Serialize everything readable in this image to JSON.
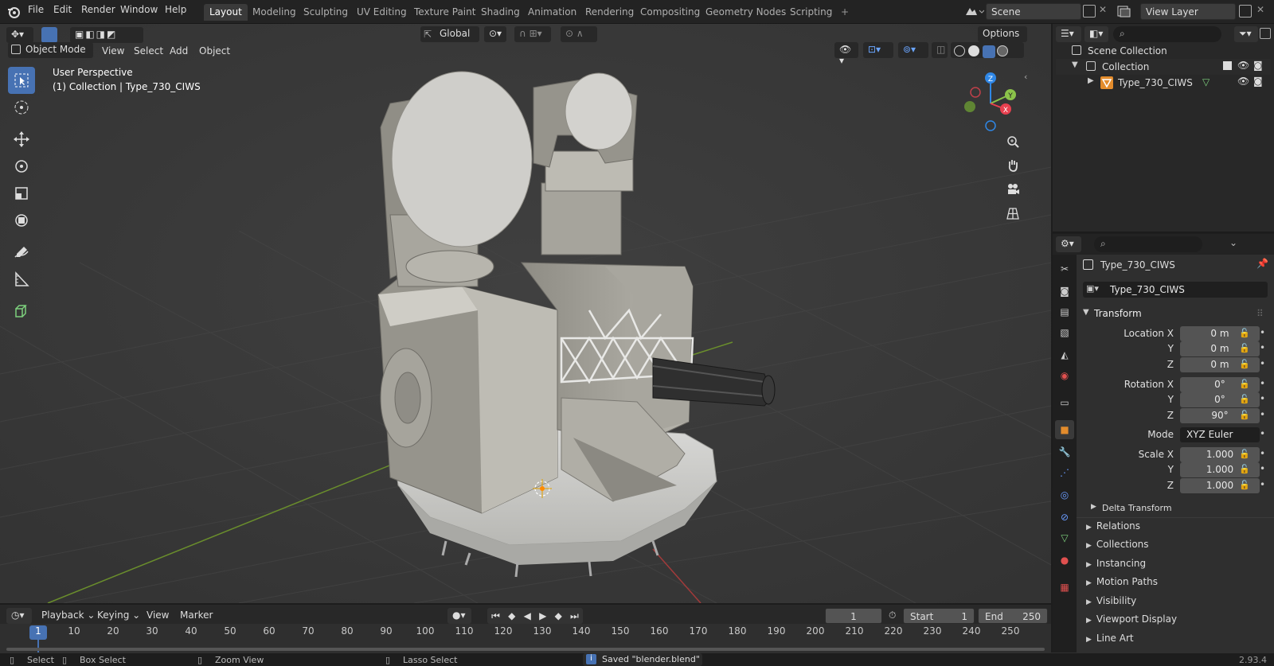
{
  "menu": {
    "file": "File",
    "edit": "Edit",
    "render": "Render",
    "window": "Window",
    "help": "Help"
  },
  "workspaces": [
    "Layout",
    "Modeling",
    "Sculpting",
    "UV Editing",
    "Texture Paint",
    "Shading",
    "Animation",
    "Rendering",
    "Compositing",
    "Geometry Nodes",
    "Scripting"
  ],
  "scene": {
    "name": "Scene",
    "view_layer": "View Layer"
  },
  "viewport": {
    "mode": "Object Mode",
    "view": "View",
    "select": "Select",
    "add": "Add",
    "object": "Object",
    "orientation": "Global",
    "options": "Options",
    "perspective": "User Perspective",
    "collection_info": "(1) Collection | Type_730_CIWS"
  },
  "gizmo": {
    "x": "X",
    "y": "Y",
    "z": "Z"
  },
  "outliner": {
    "scene_collection": "Scene Collection",
    "collection": "Collection",
    "object": "Type_730_CIWS"
  },
  "properties": {
    "object_name": "Type_730_CIWS",
    "data_name": "Type_730_CIWS",
    "transform": "Transform",
    "location_x": "Location X",
    "loc_x": "0 m",
    "loc_y": "0 m",
    "loc_z": "0 m",
    "rotation_x": "Rotation X",
    "rot_x": "0°",
    "rot_y": "0°",
    "rot_z": "90°",
    "mode_label": "Mode",
    "mode_value": "XYZ Euler",
    "scale_x": "Scale X",
    "sc_x": "1.000",
    "sc_y": "1.000",
    "sc_z": "1.000",
    "y": "Y",
    "z": "Z",
    "delta": "Delta Transform",
    "sections": [
      "Relations",
      "Collections",
      "Instancing",
      "Motion Paths",
      "Visibility",
      "Viewport Display",
      "Line Art"
    ]
  },
  "timeline": {
    "playback": "Playback",
    "keying": "Keying",
    "view": "View",
    "marker": "Marker",
    "current": "1",
    "start_label": "Start",
    "start": "1",
    "end_label": "End",
    "end": "250",
    "frames": [
      "1",
      "10",
      "20",
      "30",
      "40",
      "50",
      "60",
      "70",
      "80",
      "90",
      "100",
      "110",
      "120",
      "130",
      "140",
      "150",
      "160",
      "170",
      "180",
      "190",
      "200",
      "210",
      "220",
      "230",
      "240",
      "250"
    ]
  },
  "status": {
    "select": "Select",
    "box_select": "Box Select",
    "zoom_view": "Zoom View",
    "lasso": "Lasso Select",
    "saved": "Saved \"blender.blend\"",
    "version": "2.93.4"
  },
  "colors": {
    "accent": "#4772b3",
    "x_axis": "#e8404f",
    "y_axis": "#8bc34a",
    "z_axis": "#2f87e6",
    "object_orange": "#e38c2c"
  }
}
